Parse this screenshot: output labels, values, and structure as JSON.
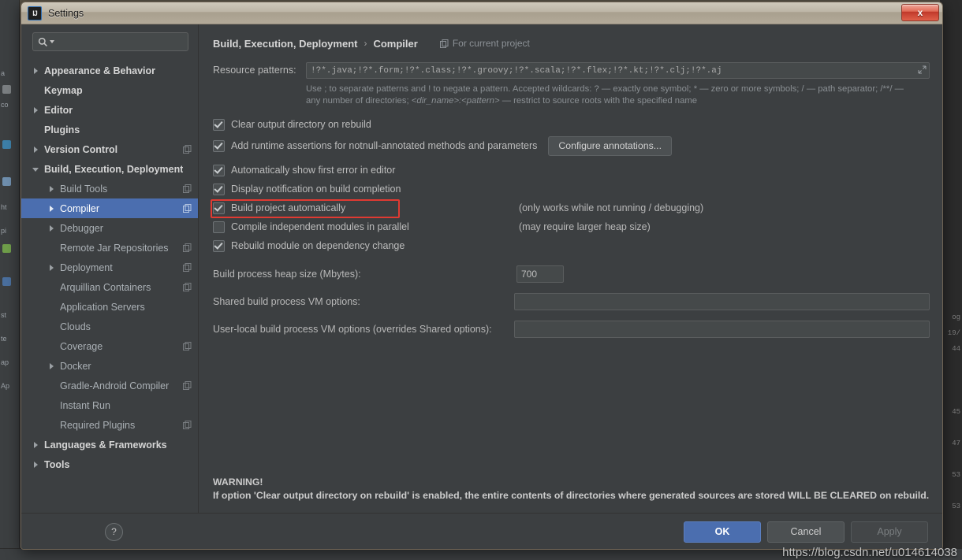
{
  "window": {
    "title": "Settings",
    "app_icon": "intellij-idea-icon",
    "close_label": "x"
  },
  "sidebar": {
    "search": {
      "placeholder": "",
      "value": "",
      "icon": "search-icon"
    },
    "items": [
      {
        "label": "Appearance & Behavior",
        "level": 0,
        "arrow": "closed",
        "bold": true,
        "copy": false,
        "selected": false
      },
      {
        "label": "Keymap",
        "level": 0,
        "arrow": "none",
        "bold": true,
        "copy": false,
        "selected": false
      },
      {
        "label": "Editor",
        "level": 0,
        "arrow": "closed",
        "bold": true,
        "copy": false,
        "selected": false
      },
      {
        "label": "Plugins",
        "level": 0,
        "arrow": "none",
        "bold": true,
        "copy": false,
        "selected": false
      },
      {
        "label": "Version Control",
        "level": 0,
        "arrow": "closed",
        "bold": true,
        "copy": true,
        "selected": false
      },
      {
        "label": "Build, Execution, Deployment",
        "level": 0,
        "arrow": "open",
        "bold": true,
        "copy": false,
        "selected": false
      },
      {
        "label": "Build Tools",
        "level": 1,
        "arrow": "closed",
        "bold": false,
        "copy": true,
        "selected": false
      },
      {
        "label": "Compiler",
        "level": 1,
        "arrow": "closed",
        "bold": false,
        "copy": true,
        "selected": true
      },
      {
        "label": "Debugger",
        "level": 1,
        "arrow": "closed",
        "bold": false,
        "copy": false,
        "selected": false
      },
      {
        "label": "Remote Jar Repositories",
        "level": 1,
        "arrow": "none",
        "bold": false,
        "copy": true,
        "selected": false
      },
      {
        "label": "Deployment",
        "level": 1,
        "arrow": "closed",
        "bold": false,
        "copy": true,
        "selected": false
      },
      {
        "label": "Arquillian Containers",
        "level": 1,
        "arrow": "none",
        "bold": false,
        "copy": true,
        "selected": false
      },
      {
        "label": "Application Servers",
        "level": 1,
        "arrow": "none",
        "bold": false,
        "copy": false,
        "selected": false
      },
      {
        "label": "Clouds",
        "level": 1,
        "arrow": "none",
        "bold": false,
        "copy": false,
        "selected": false
      },
      {
        "label": "Coverage",
        "level": 1,
        "arrow": "none",
        "bold": false,
        "copy": true,
        "selected": false
      },
      {
        "label": "Docker",
        "level": 1,
        "arrow": "closed",
        "bold": false,
        "copy": false,
        "selected": false
      },
      {
        "label": "Gradle-Android Compiler",
        "level": 1,
        "arrow": "none",
        "bold": false,
        "copy": true,
        "selected": false
      },
      {
        "label": "Instant Run",
        "level": 1,
        "arrow": "none",
        "bold": false,
        "copy": false,
        "selected": false
      },
      {
        "label": "Required Plugins",
        "level": 1,
        "arrow": "none",
        "bold": false,
        "copy": true,
        "selected": false
      },
      {
        "label": "Languages & Frameworks",
        "level": 0,
        "arrow": "closed",
        "bold": true,
        "copy": false,
        "selected": false
      },
      {
        "label": "Tools",
        "level": 0,
        "arrow": "closed",
        "bold": true,
        "copy": false,
        "selected": false
      }
    ]
  },
  "main": {
    "breadcrumb": {
      "parent": "Build, Execution, Deployment",
      "separator": "›",
      "current": "Compiler",
      "scope_label": "For current project",
      "scope_icon": "copy-scope-icon"
    },
    "resource_patterns": {
      "label": "Resource patterns:",
      "value": "!?*.java;!?*.form;!?*.class;!?*.groovy;!?*.scala;!?*.flex;!?*.kt;!?*.clj;!?*.aj",
      "expand_icon": "expand-field-icon"
    },
    "hint_line1": "Use ; to separate patterns and ! to negate a pattern. Accepted wildcards: ? — exactly one symbol; * — zero or more symbols; / — path separator; /**/ —",
    "hint_line2_pre": "any number of directories;",
    "hint_line2_italic": "<dir_name>:<pattern>",
    "hint_line2_post": "— restrict to source roots with the specified name",
    "checkboxes": [
      {
        "label": "Clear output directory on rebuild",
        "checked": true,
        "note": "",
        "button": "",
        "highlighted": false
      },
      {
        "label": "Add runtime assertions for notnull-annotated methods and parameters",
        "checked": true,
        "note": "",
        "button": "Configure annotations...",
        "highlighted": false
      },
      {
        "label": "Automatically show first error in editor",
        "checked": true,
        "note": "",
        "button": "",
        "highlighted": false
      },
      {
        "label": "Display notification on build completion",
        "checked": true,
        "note": "",
        "button": "",
        "highlighted": false
      },
      {
        "label": "Build project automatically",
        "checked": true,
        "note": "(only works while not running / debugging)",
        "button": "",
        "highlighted": true
      },
      {
        "label": "Compile independent modules in parallel",
        "checked": false,
        "note": "(may require larger heap size)",
        "button": "",
        "highlighted": false
      },
      {
        "label": "Rebuild module on dependency change",
        "checked": true,
        "note": "",
        "button": "",
        "highlighted": false
      }
    ],
    "heap": {
      "label": "Build process heap size (Mbytes):",
      "value": "700"
    },
    "shared_vm": {
      "label": "Shared build process VM options:",
      "value": ""
    },
    "user_vm": {
      "label": "User-local build process VM options (overrides Shared options):",
      "value": ""
    },
    "warning_title": "WARNING!",
    "warning_body": "If option 'Clear output directory on rebuild' is enabled, the entire contents of directories where generated sources are stored WILL BE CLEARED on rebuild."
  },
  "footer": {
    "help_label": "?",
    "ok_label": "OK",
    "cancel_label": "Cancel",
    "apply_label": "Apply"
  },
  "watermark": "https://blog.csdn.net/u014614038",
  "background": {
    "left_fragments": [
      "a",
      "co",
      "ht",
      "pi",
      "st",
      "te",
      "ap",
      "Ap"
    ],
    "right_fragments": [
      "og",
      "19/",
      "44",
      "45",
      "47",
      "53",
      "53"
    ]
  },
  "colors": {
    "accent": "#4b6eaf",
    "highlight": "#e03a32",
    "panel": "#3c3f41",
    "field": "#45494a",
    "text": "#bbbbbb"
  }
}
